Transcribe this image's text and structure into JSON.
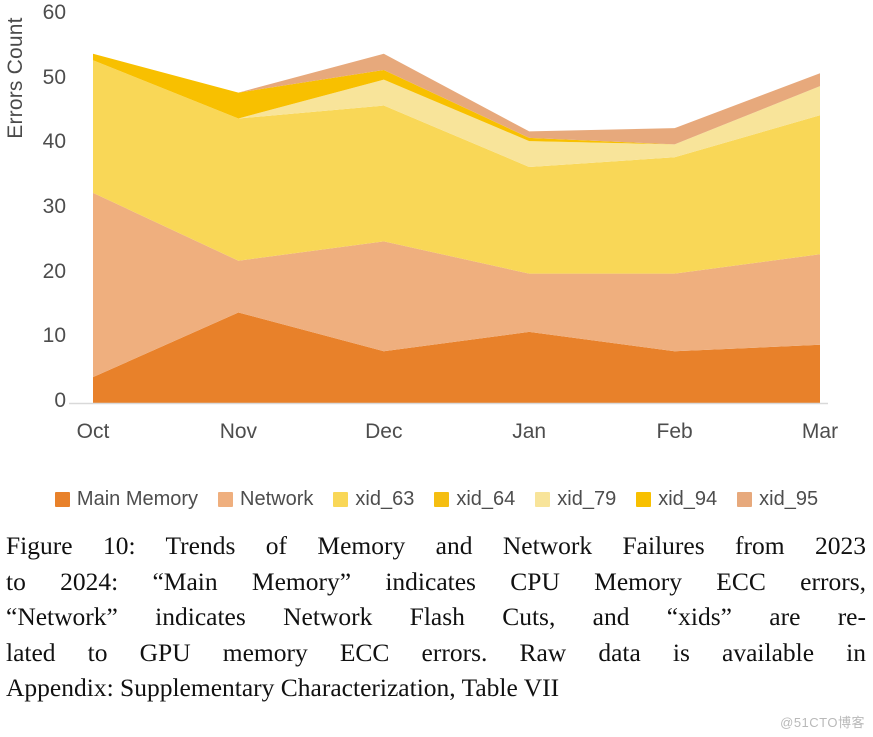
{
  "figure": {
    "watermark": "@51CTO博客",
    "caption_lines": [
      "Figure 10: Trends of Memory and Network Failures from 2023",
      "to 2024: “Main Memory” indicates CPU Memory ECC errors,",
      "“Network” indicates Network Flash Cuts, and “xids” are re-",
      "lated to GPU memory ECC errors. Raw data is available in",
      "Appendix: Supplementary Characterization, Table VII"
    ]
  },
  "chart_data": {
    "type": "area",
    "stacked": true,
    "title": "",
    "xlabel": "",
    "ylabel": "Errors Count",
    "categories": [
      "Oct",
      "Nov",
      "Dec",
      "Jan",
      "Feb",
      "Mar"
    ],
    "yticks": [
      0,
      10,
      20,
      30,
      40,
      50,
      60
    ],
    "ylim": [
      0,
      60
    ],
    "grid": false,
    "legend_position": "bottom",
    "series": [
      {
        "name": "Main Memory",
        "color": "#E8812A",
        "values": [
          4,
          14,
          8,
          11,
          8,
          9
        ]
      },
      {
        "name": "Network",
        "color": "#EFAF7E",
        "values": [
          28.5,
          8,
          17,
          9,
          12,
          14
        ]
      },
      {
        "name": "xid_63",
        "color": "#F9D757",
        "values": [
          20.5,
          22,
          21,
          16.5,
          18,
          21.5
        ]
      },
      {
        "name": "xid_64",
        "color": "#F5BE11",
        "values": [
          0,
          0,
          0,
          0,
          0,
          0
        ]
      },
      {
        "name": "xid_79",
        "color": "#F8E49A",
        "values": [
          0,
          0,
          4,
          4,
          2,
          4.5
        ]
      },
      {
        "name": "xid_94",
        "color": "#F8C000",
        "values": [
          1,
          4,
          1.5,
          0.5,
          0,
          0
        ]
      },
      {
        "name": "xid_95",
        "color": "#E7A97C",
        "values": [
          0,
          0,
          2.5,
          1,
          2.5,
          2
        ]
      }
    ],
    "cumulative_tops": {
      "Oct": [
        4,
        32.5,
        53,
        53,
        53,
        54,
        54
      ],
      "Nov": [
        14,
        22,
        44,
        44,
        44,
        48,
        48
      ],
      "Dec": [
        8,
        25,
        46,
        46,
        50,
        51.5,
        54
      ],
      "Jan": [
        11,
        20,
        36.5,
        36.5,
        40.5,
        41,
        42
      ],
      "Feb": [
        8,
        20,
        38,
        38,
        40,
        40,
        42.5
      ],
      "Mar": [
        9,
        23,
        44.5,
        44.5,
        49,
        49,
        51
      ]
    }
  }
}
